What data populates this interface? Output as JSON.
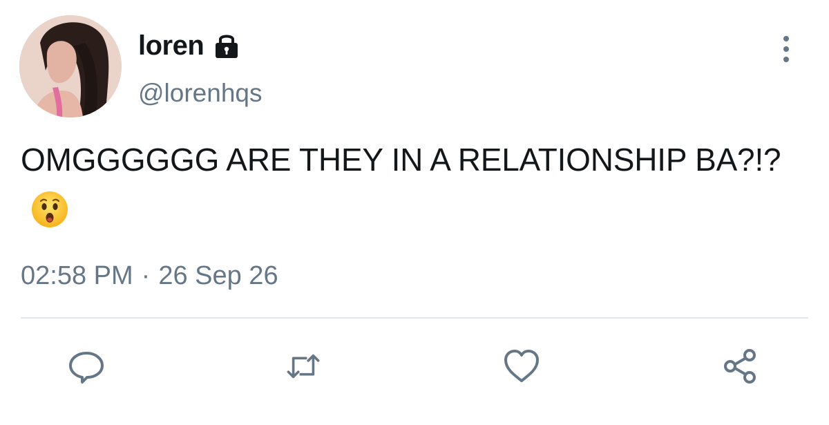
{
  "user": {
    "display_name": "loren",
    "handle": "@lorenhqs",
    "avatar_icon": "avatar-photo",
    "protected_icon": "lock-icon"
  },
  "tweet": {
    "text": "OMGGGGGG ARE THEY IN A RELATIONSHIP BA?!?",
    "emoji": "hushed-face-emoji",
    "time": "02:58 PM",
    "separator": "·",
    "date": "26 Sep 26"
  },
  "actions": {
    "reply_icon": "reply-icon",
    "retweet_icon": "retweet-icon",
    "like_icon": "heart-icon",
    "share_icon": "share-icon",
    "more_icon": "more-vertical-icon"
  },
  "colors": {
    "text": "#14171a",
    "secondary": "#657786",
    "divider": "#e1e8ed",
    "background": "#ffffff"
  }
}
